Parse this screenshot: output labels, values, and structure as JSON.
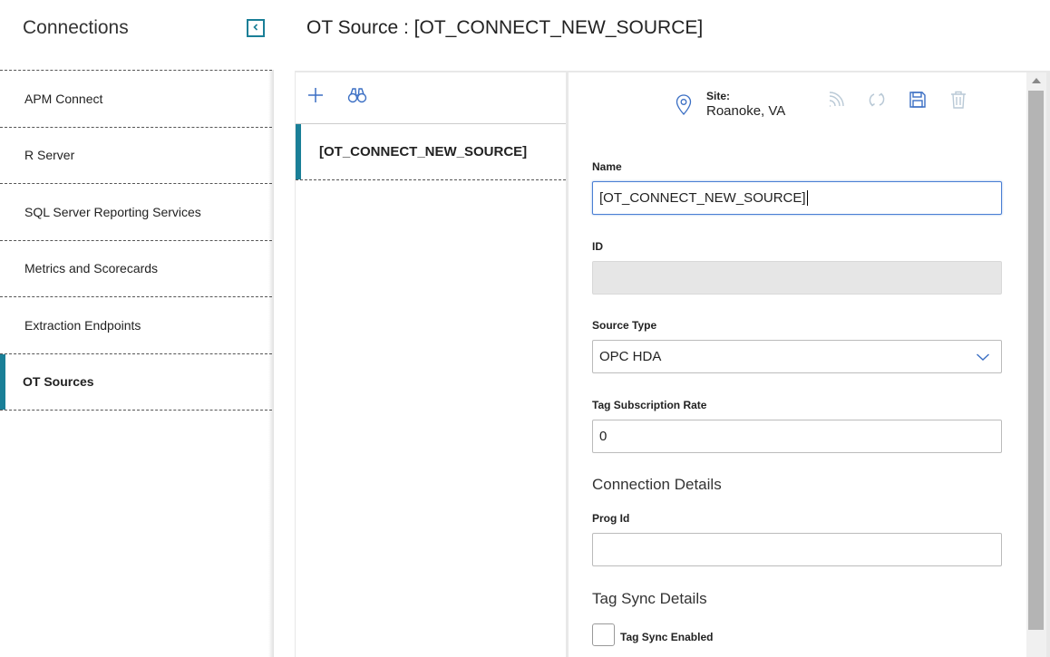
{
  "sidebar": {
    "title": "Connections",
    "items": [
      {
        "label": "APM Connect"
      },
      {
        "label": "R Server"
      },
      {
        "label": "SQL Server Reporting Services"
      },
      {
        "label": "Metrics and Scorecards"
      },
      {
        "label": "Extraction Endpoints"
      },
      {
        "label": "OT Sources"
      }
    ],
    "active_index": 5
  },
  "header": {
    "title": "OT Source : [OT_CONNECT_NEW_SOURCE]"
  },
  "list": {
    "items": [
      {
        "label": "[OT_CONNECT_NEW_SOURCE]"
      }
    ]
  },
  "detail": {
    "site_label": "Site:",
    "site_value": "Roanoke, VA",
    "fields": {
      "name": {
        "label": "Name",
        "value": "[OT_CONNECT_NEW_SOURCE]"
      },
      "id": {
        "label": "ID",
        "value": ""
      },
      "source_type": {
        "label": "Source Type",
        "value": "OPC HDA"
      },
      "tag_subscription_rate": {
        "label": "Tag Subscription Rate",
        "value": "0"
      },
      "prog_id": {
        "label": "Prog Id",
        "value": ""
      }
    },
    "sections": {
      "connection_details": "Connection Details",
      "tag_sync_details": "Tag Sync Details"
    },
    "tag_sync_enabled": {
      "label": "Tag Sync Enabled",
      "checked": false
    }
  },
  "icons": {
    "collapse": "chevron-left-icon",
    "add": "plus-icon",
    "search": "binoculars-icon",
    "site": "location-pin-icon",
    "rss": "rss-feed-icon",
    "refresh": "refresh-icon",
    "save": "save-icon",
    "delete": "trash-icon"
  },
  "colors": {
    "accent": "#1a7f97",
    "icon_blue": "#3b6fc4",
    "icon_disabled": "#b9c9d6"
  }
}
